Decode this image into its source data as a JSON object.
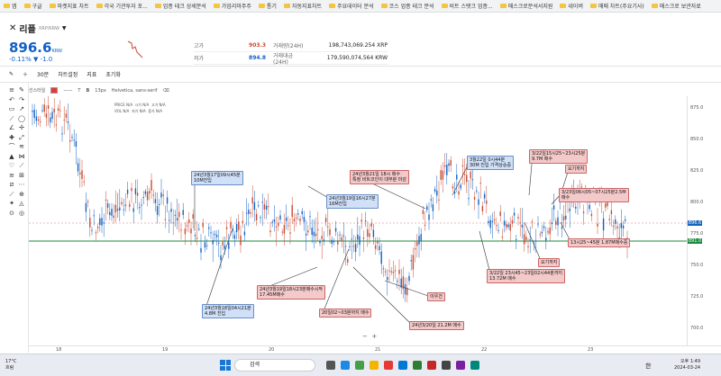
{
  "bookmarks": [
    "앱",
    "구글",
    "마켓지표 차트",
    "각국 기관투자 포...",
    "업종 테크 상세분석",
    "가업리마주주",
    "통기",
    "자동지표차트",
    "주요데이터 분석",
    "코스 업종 테크 분석",
    "비트 스탯크 업종...",
    "매스크로분석서지원",
    "네이버",
    "매매 차트(주요기사)",
    "매스크로 보관자료"
  ],
  "coin": {
    "name": "리플",
    "pair": "XRP/KRW"
  },
  "price": {
    "value": "896.6",
    "unit": "KRW",
    "change": "-0.11% ▼ -1.0"
  },
  "stats": [
    {
      "label": "고가",
      "value": "903.3",
      "label2": "거래량(24H)",
      "value2": "198,743,069.254 XRP"
    },
    {
      "label": "저가",
      "value": "894.8",
      "label2": "거래대금(24H)",
      "value2": "179,590,074,564 KRW"
    }
  ],
  "toolbar": [
    "30분",
    "차트설정",
    "지표",
    "초기화"
  ],
  "drawbar": {
    "label": "선스타일",
    "size": "13px",
    "font": "Helvetica, sans-serif"
  },
  "legend": [
    [
      "PRICE",
      "N/A",
      "시가",
      "N/A",
      "고가",
      "N/A"
    ],
    [
      "VOL",
      "N/A",
      "저가",
      "N/A",
      "종가",
      "N/A"
    ]
  ],
  "annotations": [
    {
      "text": "24년3월17일09시45분\n10M진입",
      "color": "blue"
    },
    {
      "text": "24년3월19일16시27분\n16M진입",
      "color": "blue"
    },
    {
      "text": "24년3월21일 18시 매수\n특정 비트코인이 대부분 마감",
      "color": "pink"
    },
    {
      "text": "3월22일 0시44분\n30M 진입 가격상승중",
      "color": "blue"
    },
    {
      "text": "3/22일15시25~23시25분\n9.7M 매수",
      "color": "pink"
    },
    {
      "text": "요기까지",
      "color": "pink"
    },
    {
      "text": "3/23일06시05~07시25분2.5M\n매수",
      "color": "pink"
    },
    {
      "text": "13시25~45분 1.87M매수중",
      "color": "pink"
    },
    {
      "text": "24년3월19일18시23분매수시작\n17.45M매수",
      "color": "pink"
    },
    {
      "text": "24년3월18일04시21분\n4.8M 진입",
      "color": "blue"
    },
    {
      "text": "20일02~03분까지 매수",
      "color": "pink"
    },
    {
      "text": "이우건",
      "color": "pink"
    },
    {
      "text": "24년3/20일 21.2M 매수",
      "color": "pink"
    },
    {
      "text": "3/22일 23시45~23일02시44분까지\n13.72M 매수",
      "color": "pink"
    },
    {
      "text": "요기까지",
      "color": "pink"
    }
  ],
  "y_ticks": [
    "875.0",
    "850.0",
    "825.0",
    "800.0",
    "775.0",
    "750.0",
    "725.0",
    "700.0"
  ],
  "price_tags": [
    {
      "value": "896.6",
      "color": "#1261c4"
    },
    {
      "value": "891.0",
      "color": "#1b8a3f"
    }
  ],
  "x_ticks": [
    "18",
    "19",
    "20",
    "21",
    "22",
    "23"
  ],
  "taskbar": {
    "weather_temp": "17°C",
    "weather_desc": "흐림",
    "search": "검색",
    "time": "오후 1:49",
    "date": "2024-03-24",
    "lang": "한"
  }
}
